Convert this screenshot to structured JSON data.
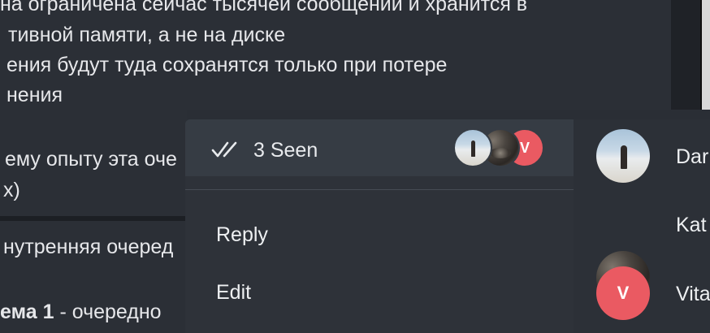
{
  "background": {
    "lines": [
      "на ограничена сейчас тысячей сообщений и хранится в",
      "тивной памяти, а не на диске",
      "ения будут туда сохранятся только при потере",
      "нения",
      "ему опыту эта оче",
      "x)",
      "нутренняя очеред",
      "ема 1",
      " - очередно"
    ]
  },
  "menu": {
    "seen_label": "3 Seen",
    "reply_label": "Reply",
    "edit_label": "Edit",
    "stack_letter": "V"
  },
  "seen_by": [
    {
      "name": "Dar",
      "avatar": "beach-photo"
    },
    {
      "name": "Kat",
      "avatar": "rocks-photo"
    },
    {
      "name": "Vita",
      "avatar": "letter",
      "letter": "V"
    }
  ],
  "colors": {
    "letter_avatar": "#ea5a62",
    "menu_bg": "#2e3239",
    "seen_row_bg": "#363c44"
  }
}
